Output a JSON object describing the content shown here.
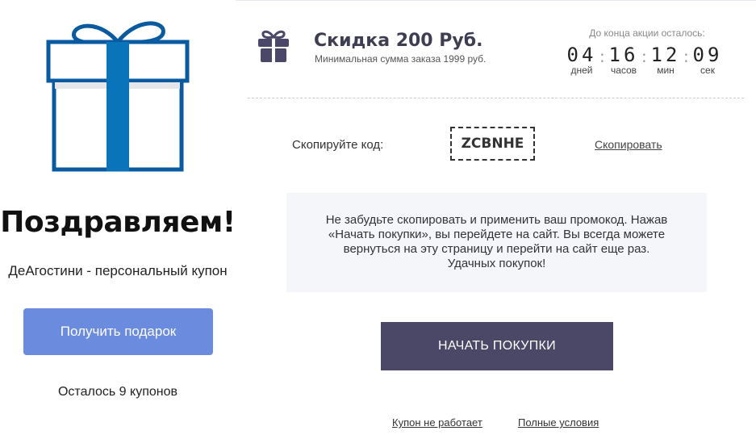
{
  "left": {
    "congrats": "Поздравляем!",
    "subtitle": "ДеАгостини - персональный купон",
    "get_gift_label": "Получить подарок",
    "coupons_left": "Осталось 9 купонов"
  },
  "offer": {
    "title": "Скидка 200 Руб.",
    "subtitle": "Минимальная сумма заказа 1999 руб."
  },
  "timer": {
    "caption": "До конца акции осталось:",
    "days": "04",
    "days_label": "дней",
    "hours": "16",
    "hours_label": "часов",
    "minutes": "12",
    "minutes_label": "мин",
    "seconds": "09",
    "seconds_label": "сек"
  },
  "code": {
    "label": "Скопируйте код:",
    "value": "ZCBNHE",
    "copy_label": "Скопировать"
  },
  "info": {
    "lines": [
      "Не забудьте скопировать и применить ваш промокод. Нажав",
      "«Начать покупки», вы перейдете на сайт. Вы всегда можете",
      "вернуться на эту страницу и перейти на сайт еще раз.",
      "Удачных покупок!"
    ]
  },
  "start_button": "НАЧАТЬ ПОКУПКИ",
  "footer": {
    "not_working": "Купон не работает",
    "full_terms": "Полные условия"
  },
  "colors": {
    "gift_blue": "#0a5aa0",
    "gift_band": "#0a74bb",
    "gift_button": "#6b8bde",
    "primary_dark": "#4b4767",
    "icon_purple": "#4a4768",
    "info_bg": "#f4f6fa"
  }
}
